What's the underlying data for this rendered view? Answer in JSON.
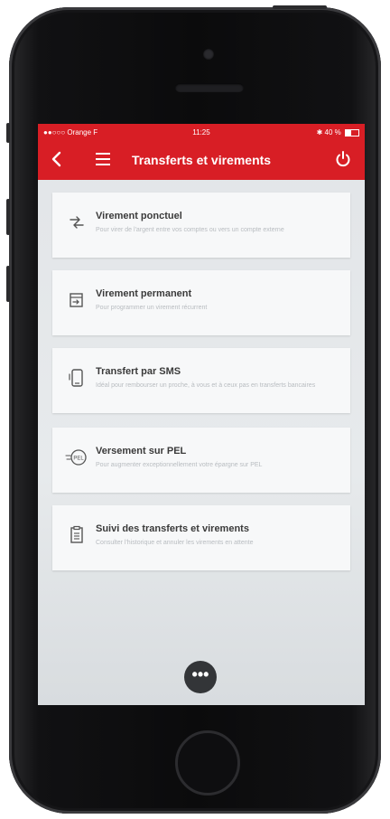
{
  "status_bar": {
    "carrier": "●●○○○ Orange F",
    "time": "11:25",
    "battery": "40 %"
  },
  "app_bar": {
    "title": "Transferts et virements",
    "back_icon": "chevron-left-icon",
    "menu_icon": "hamburger-icon",
    "power_icon": "power-icon"
  },
  "cards": [
    {
      "title": "Virement ponctuel",
      "description": "Pour virer de l'argent entre vos comptes ou vers un compte externe",
      "icon": "exchange-icon"
    },
    {
      "title": "Virement permanent",
      "description": "Pour programmer un virement récurrent",
      "icon": "calendar-transfer-icon"
    },
    {
      "title": "Transfert par SMS",
      "description": "Idéal pour rembourser un proche, à vous et à ceux pas en transferts bancaires",
      "icon": "phone-sms-icon"
    },
    {
      "title": "Versement sur PEL",
      "description": "Pour augmenter exceptionnellement votre épargne sur PEL",
      "icon": "pel-coin-icon"
    },
    {
      "title": "Suivi des transferts et virements",
      "description": "Consulter l'historique et annuler les virements en attente",
      "icon": "clipboard-list-icon"
    }
  ],
  "fab": {
    "label": "•••",
    "icon": "more-icon"
  },
  "colors": {
    "brand_red": "#d81e25",
    "screen_bg": "#e4e7ea",
    "card_bg": "#f7f8f9",
    "fab_bg": "#333538"
  }
}
